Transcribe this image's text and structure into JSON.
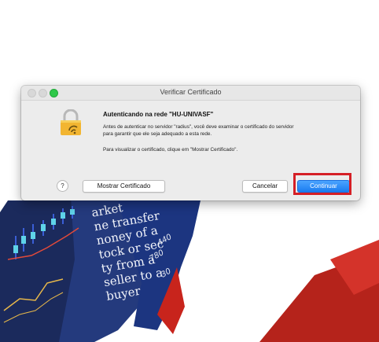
{
  "dialog": {
    "title": "Verificar Certificado",
    "heading": "Autenticando na rede \"HU-UNIVASF\"",
    "message_line1": "Antes de autenticar no servidor \"radius\", você deve examinar o certificado do servidor",
    "message_line2": "para garantir que ele seja adequado a esta rede.",
    "message_view": "Para visualizar o certificado, clique em \"Mostrar Certificado\".",
    "help_label": "?",
    "show_certificate_label": "Mostrar Certificado",
    "cancel_label": "Cancelar",
    "continue_label": "Continuar",
    "highlight_color": "#d51f26",
    "accent_color": "#1a7cf0"
  },
  "background": {
    "text_lines": [
      "arket",
      "ne transfer",
      "noney of a",
      "tock or sec",
      "ty from a",
      "seller to a",
      "buyer"
    ],
    "numbers": [
      "440",
      "780",
      "30"
    ]
  }
}
